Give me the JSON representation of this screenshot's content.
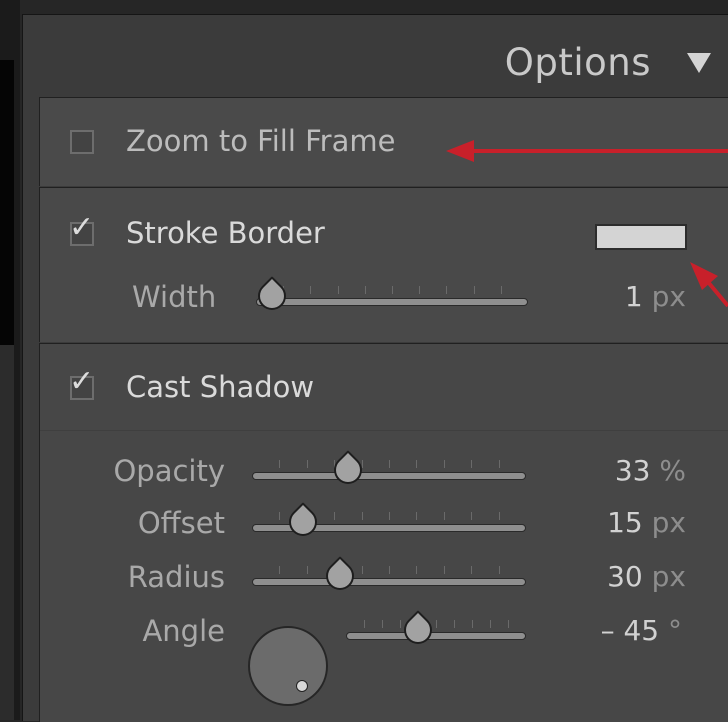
{
  "panel": {
    "title": "Options"
  },
  "zoom_to_fill": {
    "label": "Zoom to Fill Frame",
    "checked": false
  },
  "stroke_border": {
    "label": "Stroke Border",
    "checked": true,
    "color": "#d4d4d4",
    "width": {
      "label": "Width",
      "value": "1",
      "unit": "px",
      "level": 0
    }
  },
  "cast_shadow": {
    "label": "Cast Shadow",
    "checked": true,
    "opacity": {
      "label": "Opacity",
      "value": "33",
      "unit": "%",
      "level": 0.33
    },
    "offset": {
      "label": "Offset",
      "value": "15",
      "unit": "px",
      "level": 0.15
    },
    "radius": {
      "label": "Radius",
      "value": "30",
      "unit": "px",
      "level": 0.3
    },
    "angle": {
      "label": "Angle",
      "value": "– 45",
      "unit": "°",
      "level": 0.375
    }
  },
  "colors": {
    "annotation_arrow": "#c8202a"
  }
}
